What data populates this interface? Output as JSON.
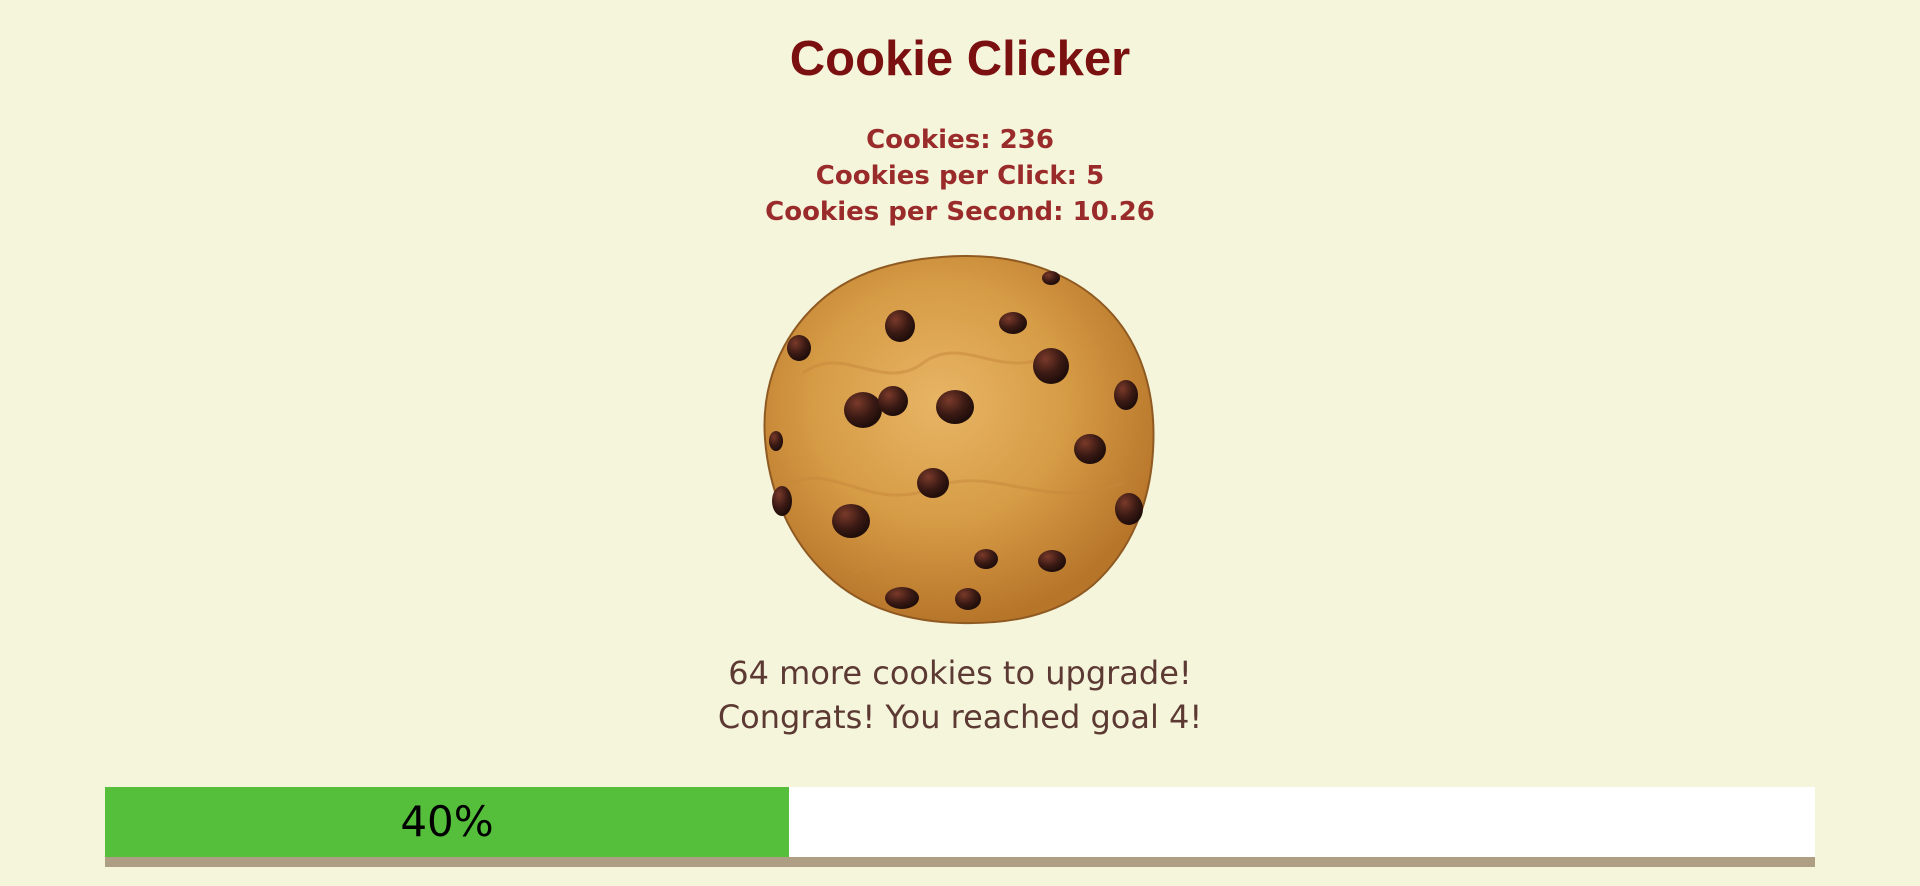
{
  "game": {
    "title": "Cookie Clicker"
  },
  "stats": {
    "cookies": "Cookies: 236",
    "per_click": "Cookies per Click: 5",
    "per_second": "Cookies per Second: 10.26"
  },
  "cookie": {
    "icon": "chocolate-chip-cookie"
  },
  "messages": {
    "upgrade": "64 more cookies to upgrade!",
    "goal": "Congrats! You reached goal 4!"
  },
  "progress": {
    "percent": 40,
    "label": "40%"
  },
  "colors": {
    "background": "#f5f5dc",
    "title": "#7b1010",
    "stats": "#9a2b2b",
    "message": "#5c3a33",
    "progress_fill": "#55bf3b",
    "progress_track": "#ffffff",
    "progress_border": "#ad9e84"
  }
}
